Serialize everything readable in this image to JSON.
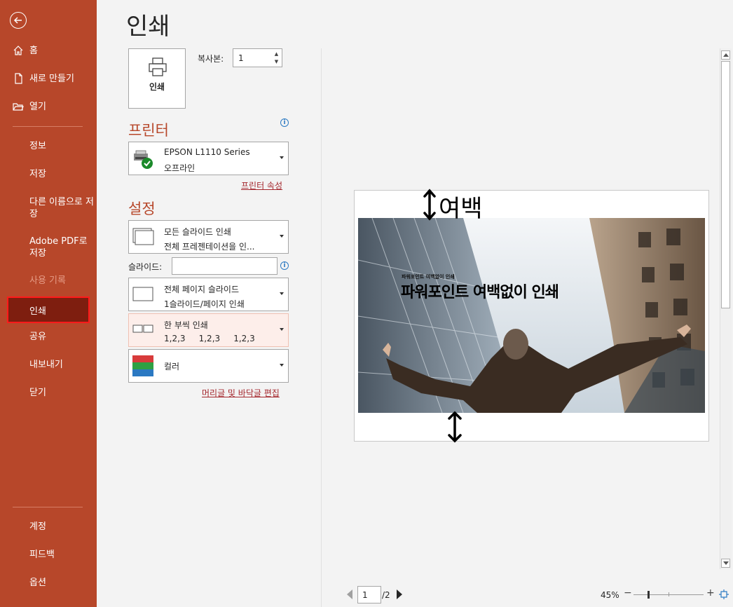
{
  "sidebar": {
    "home": "홈",
    "new": "새로 만들기",
    "open": "열기",
    "info": "정보",
    "save": "저장",
    "save_as": "다른 이름으로 저장",
    "adobe_pdf": "Adobe PDF로 저장",
    "history": "사용 기록",
    "print": "인쇄",
    "share": "공유",
    "export": "내보내기",
    "close": "닫기",
    "account": "계정",
    "feedback": "피드백",
    "options": "옵션",
    "accent_color": "#b7472a"
  },
  "main": {
    "title": "인쇄",
    "print_button": "인쇄",
    "copies_label": "복사본:",
    "copies_value": "1"
  },
  "printer": {
    "section_title": "프린터",
    "name": "EPSON L1110 Series",
    "status": "오프라인",
    "properties_link": "프린터 속성"
  },
  "settings": {
    "section_title": "설정",
    "range_title": "모든 슬라이드 인쇄",
    "range_sub": "전체 프레젠테이션을 인...",
    "slides_label": "슬라이드:",
    "slides_value": "",
    "layout_title": "전체 페이지 슬라이드",
    "layout_sub": "1슬라이드/페이지 인쇄",
    "collate_title": "한 부씩 인쇄",
    "collate_sub": "1,2,3     1,2,3     1,2,3",
    "color_title": "컬러",
    "header_footer_link": "머리글 및 바닥글 편집"
  },
  "preview": {
    "slide_subtitle": "파워포인트 여백없이 인쇄",
    "slide_title": "파워포인트 여백없이 인쇄",
    "annotation": "여백"
  },
  "footer": {
    "page_current": "1",
    "page_total": "/2",
    "zoom": "45%",
    "zoom_minus": "−",
    "zoom_plus": "+"
  }
}
